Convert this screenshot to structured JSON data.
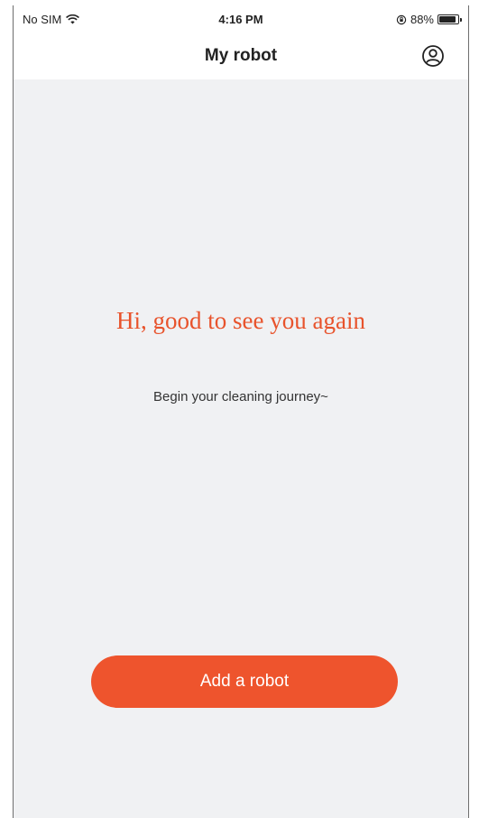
{
  "status_bar": {
    "carrier": "No SIM",
    "time": "4:16 PM",
    "battery_percent": "88%",
    "battery_level": 0.88
  },
  "navbar": {
    "title": "My robot",
    "profile_icon": "user-circle-icon"
  },
  "main": {
    "greeting": "Hi, good to see you again",
    "subtitle": "Begin your cleaning journey~",
    "add_button_label": "Add a robot"
  },
  "colors": {
    "accent": "#ee542d",
    "greeting_text": "#e8532c",
    "background": "#f0f1f3"
  }
}
